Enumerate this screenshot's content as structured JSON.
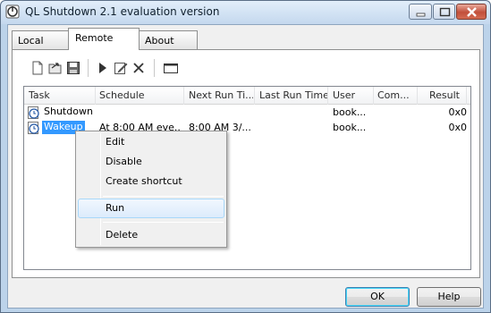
{
  "window": {
    "title": "QL Shutdown 2.1 evaluation version"
  },
  "tabs": [
    {
      "label": "Local"
    },
    {
      "label": "Remote"
    },
    {
      "label": "About"
    }
  ],
  "columns": [
    "Task",
    "Schedule",
    "Next Run Ti...",
    "Last Run Time",
    "User",
    "Com...",
    "Result"
  ],
  "rows": [
    {
      "task": "Shutdown",
      "schedule": "",
      "next_run": "",
      "last_run": "",
      "user": "book...",
      "comment": "",
      "result": "0x0"
    },
    {
      "task": "Wakeup",
      "schedule": "At 8:00 AM eve...",
      "next_run": "8:00 AM 3/...",
      "last_run": "",
      "user": "book...",
      "comment": "",
      "result": "0x0"
    }
  ],
  "context_menu": {
    "items": [
      "Edit",
      "Disable",
      "Create shortcut",
      "Run",
      "Delete"
    ],
    "hovered": "Run"
  },
  "buttons": {
    "ok": "OK",
    "help": "Help"
  },
  "colors": {
    "selection": "#3399ff",
    "accent": "#3c7fb1"
  }
}
